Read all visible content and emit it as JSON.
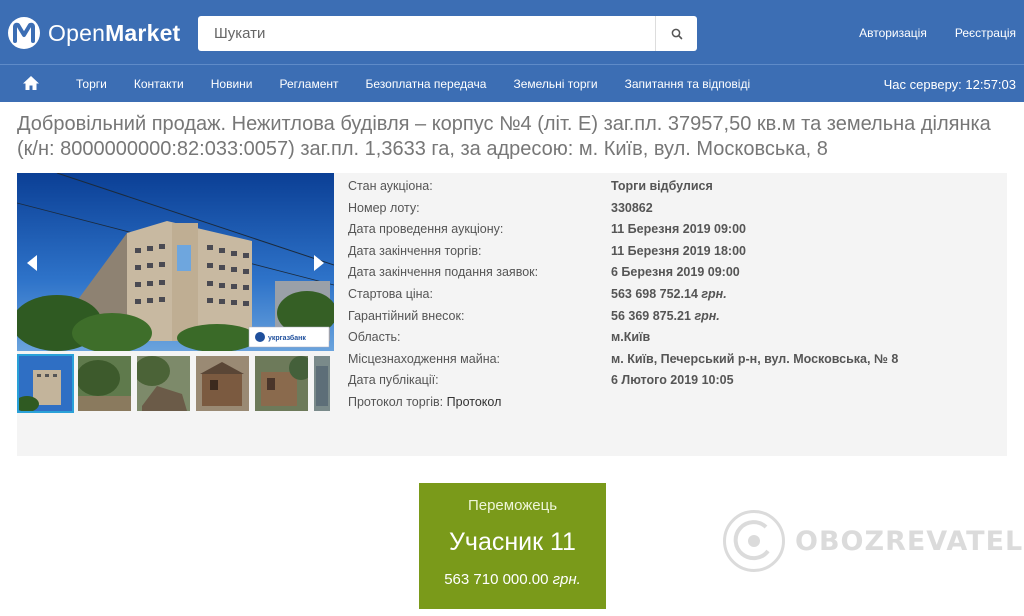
{
  "brand": {
    "name_light": "Open",
    "name_bold": "Market",
    "logo_icon": "openmarket-logo-icon"
  },
  "search": {
    "placeholder": "Шукати",
    "icon": "search-icon"
  },
  "top_links": {
    "login": "Авторизація",
    "register": "Реєстрація"
  },
  "nav": {
    "home_icon": "home-icon",
    "items": [
      "Торги",
      "Контакти",
      "Новини",
      "Регламент",
      "Безоплатна передача",
      "Земельні торги",
      "Запитання та відповіді"
    ],
    "server_time": "Час серверу: 12:57:03"
  },
  "title": "Добровільний продаж. Нежитлова будівля – корпус №4 (літ. Е) заг.пл. 37957,50 кв.м та земельна ділянка (к/н: 8000000000:82:033:0057) заг.пл. 1,3633 га, за адресою: м. Київ, вул. Московська, 8",
  "details": {
    "status": {
      "label": "Стан аукціона:",
      "value": "Торги відбулися"
    },
    "lot": {
      "label": "Номер лоту:",
      "value": "330862"
    },
    "auction_date": {
      "label": "Дата проведення аукціону:",
      "value": "11 Березня 2019 09:00"
    },
    "end_date": {
      "label": "Дата закінчення торгів:",
      "value": "11 Березня 2019 18:00"
    },
    "app_end_date": {
      "label": "Дата закінчення подання заявок:",
      "value": "6 Березня 2019 09:00"
    },
    "start_price": {
      "label": "Стартова ціна:",
      "value": "563 698 752.14",
      "currency": "грн."
    },
    "deposit": {
      "label": "Гарантійний внесок:",
      "value": "56 369 875.21",
      "currency": "грн."
    },
    "region": {
      "label": "Область:",
      "value": "м.Київ"
    },
    "location": {
      "label": "Місцезнаходження майна:",
      "value": "м. Київ, Печерський р-н, вул. Московська, № 8"
    },
    "published": {
      "label": "Дата публікації:",
      "value": "6 Лютого 2019 10:05"
    },
    "protocol": {
      "label": "Протокол торгів:",
      "link": "Протокол"
    }
  },
  "photo_banner_text": "укргазбанк",
  "winner": {
    "label": "Переможець",
    "name": "Учасник 11",
    "price": "563 710 000.00",
    "currency": "грн."
  },
  "watermark": {
    "text": "OBOZREVATEL"
  },
  "colors": {
    "header": "#3c6eb4",
    "winner": "#7a9a1a",
    "panel": "#f4f4f4",
    "thumb_active": "#2aa1d8"
  }
}
